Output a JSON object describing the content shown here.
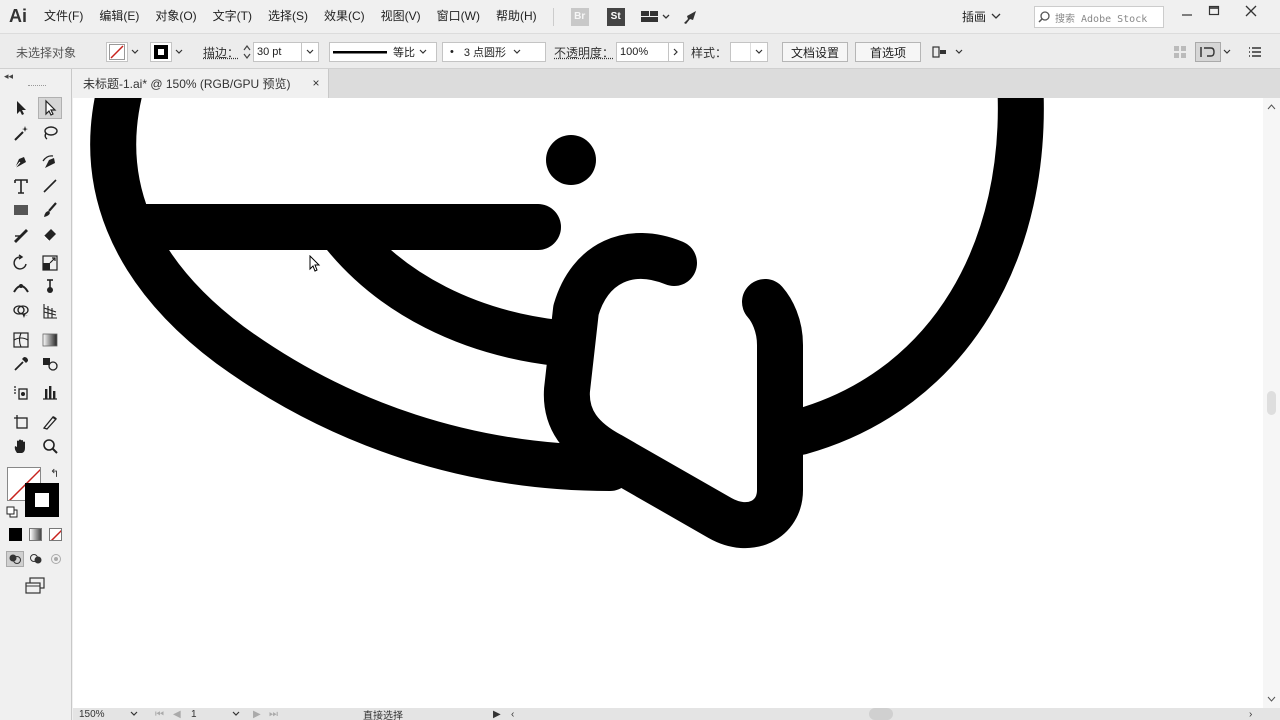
{
  "app": {
    "logo": "Ai"
  },
  "menu": {
    "items": [
      "文件(F)",
      "编辑(E)",
      "对象(O)",
      "文字(T)",
      "选择(S)",
      "效果(C)",
      "视图(V)",
      "窗口(W)",
      "帮助(H)"
    ],
    "bridge_badge": "Br",
    "stock_badge": "St",
    "workspace": "插画",
    "search_placeholder": "搜索 Adobe Stock"
  },
  "control": {
    "selection_status": "未选择对象",
    "stroke_label": "描边：",
    "stroke_weight": "30 pt",
    "profile_label": "等比",
    "brush_dot": "•",
    "brush_label": "3 点圆形",
    "opacity_label": "不透明度：",
    "opacity_value": "100%",
    "style_label": "样式：",
    "doc_setup_button": "文档设置",
    "prefs_button": "首选项"
  },
  "document": {
    "tab_title": "未标题-1.ai* @ 150% (RGB/GPU 预览)",
    "close_glyph": "×"
  },
  "status": {
    "zoom": "150%",
    "artboard": "1",
    "tool_name": "直接选择"
  },
  "colors": {
    "artwork": "#000000",
    "canvas": "#ffffff",
    "chrome": "#f0f0f0",
    "no_fill_slash": "#c8221d"
  },
  "icons": {
    "tools": [
      "selection-tool-icon",
      "direct-selection-tool-icon",
      "magic-wand-icon",
      "lasso-icon",
      "pen-tool-icon",
      "curvature-tool-icon",
      "type-tool-icon",
      "line-segment-tool-icon",
      "rectangle-tool-icon",
      "paintbrush-tool-icon",
      "shaper-tool-icon",
      "eraser-tool-icon",
      "rotate-tool-icon",
      "scale-tool-icon",
      "width-tool-icon",
      "puppet-warp-icon",
      "shape-builder-icon",
      "perspective-grid-icon",
      "mesh-tool-icon",
      "gradient-tool-icon",
      "eyedropper-icon",
      "blend-tool-icon",
      "symbol-sprayer-icon",
      "column-graph-icon",
      "artboard-tool-icon",
      "slice-tool-icon",
      "hand-tool-icon",
      "zoom-tool-icon"
    ]
  }
}
